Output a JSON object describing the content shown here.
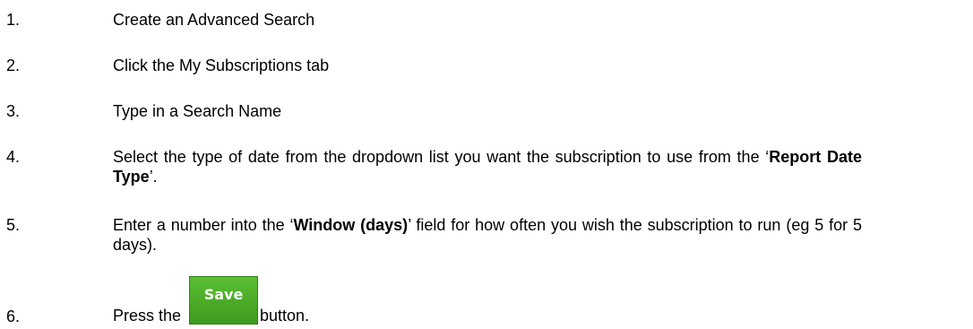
{
  "steps": [
    {
      "number": "1.",
      "text": "Create an Advanced Search"
    },
    {
      "number": "2.",
      "text": "Click the My Subscriptions tab"
    },
    {
      "number": "3.",
      "text": "Type in a Search Name"
    },
    {
      "number": "4.",
      "text_before": "Select the type of date from the dropdown list you want the subscription to use from the ‘",
      "bold": "Report Date Type",
      "text_after": "’."
    },
    {
      "number": "5.",
      "text_before": "Enter a number into the ‘",
      "bold": "Window (days)",
      "text_after": "’ field for how often you wish the subscription to run (eg 5 for 5 days)."
    },
    {
      "number": "6.",
      "text_before": "Press the",
      "button_label": "Save",
      "text_after": "button."
    }
  ],
  "colors": {
    "save_button": "#4aae26"
  }
}
